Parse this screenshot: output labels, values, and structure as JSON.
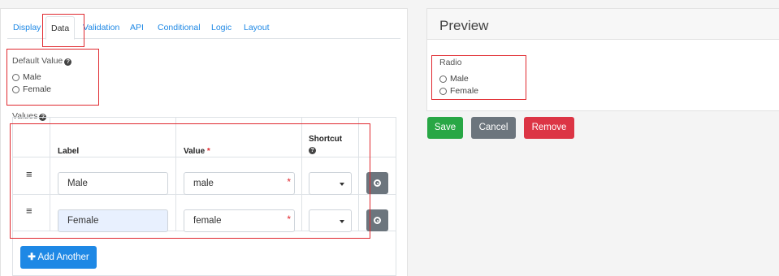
{
  "tabs": [
    "Display",
    "Data",
    "Validation",
    "API",
    "Conditional",
    "Logic",
    "Layout"
  ],
  "active_tab": "Data",
  "default_value": {
    "label": "Default Value",
    "help_icon": "question-circle-icon",
    "options": [
      "Male",
      "Female"
    ]
  },
  "values": {
    "label": "Values",
    "help_icon": "question-circle-icon",
    "headers": {
      "label": "Label",
      "value": "Value",
      "required_mark": "*",
      "shortcut": "Shortcut"
    },
    "rows": [
      {
        "label": "Male",
        "value": "male",
        "shortcut": ""
      },
      {
        "label": "Female",
        "value": "female",
        "shortcut": ""
      }
    ],
    "add_label": "Add Another"
  },
  "preview": {
    "title": "Preview",
    "field_label": "Radio",
    "options": [
      "Male",
      "Female"
    ]
  },
  "buttons": {
    "save": "Save",
    "cancel": "Cancel",
    "remove": "Remove"
  },
  "colors": {
    "primary": "#1e88e5",
    "success": "#28a745",
    "secondary": "#6c757d",
    "danger": "#dc3545",
    "highlight_box": "#e0282e"
  }
}
